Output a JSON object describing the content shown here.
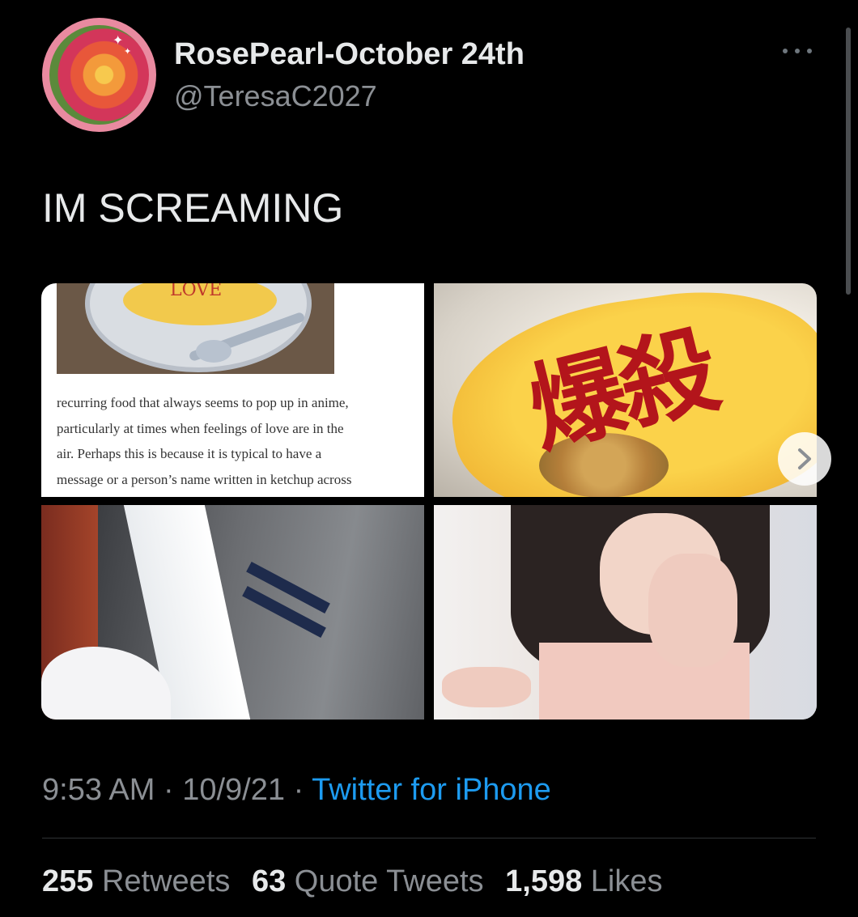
{
  "user": {
    "display_name": "RosePearl-October 24th",
    "handle": "@TeresaC2027",
    "avatar_icon": "rose-avatar"
  },
  "tweet": {
    "text": "IM SCREAMING"
  },
  "media": {
    "image1": {
      "anime_label": "LOVE",
      "article_lines": [
        "recurring food that always seems to pop up in anime,",
        "particularly at times when feelings of love are in the",
        "air. Perhaps this is because it is typical to have a",
        "message or a person’s name written in ketchup across"
      ]
    },
    "image2": {
      "ketchup_text": "爆殺"
    },
    "next_icon": "chevron-right-icon"
  },
  "meta": {
    "time": "9:53 AM",
    "separator": "·",
    "date": "10/9/21",
    "source": "Twitter for iPhone"
  },
  "stats": {
    "retweets_count": "255",
    "retweets_label": "Retweets",
    "quotes_count": "63",
    "quotes_label": "Quote Tweets",
    "likes_count": "1,598",
    "likes_label": "Likes"
  },
  "colors": {
    "background": "#000000",
    "accent": "#1d9bf0",
    "secondary_text": "#8b8f94",
    "avatar_ring": "#e98aa0"
  }
}
